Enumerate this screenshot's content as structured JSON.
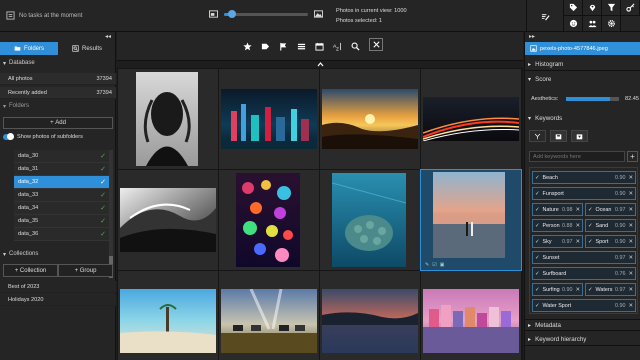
{
  "topbar": {
    "tasks_text": "No tasks at the moment",
    "zoom_level": 0.1,
    "photos_in_view_label": "Photos in current view:",
    "photos_in_view_value": "1000",
    "photos_selected_label": "Photos selected:",
    "photos_selected_value": "1"
  },
  "left": {
    "collapse": "◂◂",
    "tabs": [
      {
        "label": "Folders"
      },
      {
        "label": "Results"
      }
    ],
    "database_header": "Database",
    "database_rows": [
      {
        "label": "All photos",
        "count": "37394"
      },
      {
        "label": "Recently added",
        "count": "37394"
      }
    ],
    "folders_header": "Folders",
    "add_label": "Add",
    "show_subfolders": "Show photos of subfolders",
    "folders": [
      {
        "name": "data_30"
      },
      {
        "name": "data_31"
      },
      {
        "name": "data_32"
      },
      {
        "name": "data_33"
      },
      {
        "name": "data_34"
      },
      {
        "name": "data_35"
      },
      {
        "name": "data_36"
      }
    ],
    "collections_header": "Collections",
    "collection_btn": "Collection",
    "group_btn": "Group",
    "collections": [
      {
        "name": "Best of 2023"
      },
      {
        "name": "Holidays 2020"
      }
    ]
  },
  "right": {
    "collapse": "▸▸",
    "filename": "pexels-photo-4577846.jpeg",
    "sections": {
      "histogram": "Histogram",
      "score": "Score",
      "keywords": "Keywords",
      "metadata": "Metadata",
      "hierarchy": "Keyword hierarchy"
    },
    "aesthetics_label": "Aesthetics:",
    "aesthetics_value": "82.45",
    "aesthetics_fraction": 0.8245,
    "keyword_placeholder": "Add keywords here",
    "keywords": [
      {
        "name": "Beach",
        "score": "0.90"
      },
      {
        "name": "Funsport",
        "score": "0.90"
      },
      {
        "name": "Nature",
        "score": "0.98"
      },
      {
        "name": "Ocean",
        "score": "0.97"
      },
      {
        "name": "Person",
        "score": "0.88"
      },
      {
        "name": "Sand",
        "score": "0.90"
      },
      {
        "name": "Sky",
        "score": "0.97"
      },
      {
        "name": "Sport",
        "score": "0.90"
      },
      {
        "name": "Sunset",
        "score": "0.97"
      },
      {
        "name": "Surfboard",
        "score": "0.76"
      },
      {
        "name": "Surfing",
        "score": "0.90"
      },
      {
        "name": "Waters",
        "score": "0.97"
      },
      {
        "name": "Water Sport",
        "score": "0.90"
      }
    ]
  },
  "colors": {
    "accent": "#2f8fd8",
    "check": "#4caf50",
    "panel": "#252525",
    "grid": "#161616"
  }
}
